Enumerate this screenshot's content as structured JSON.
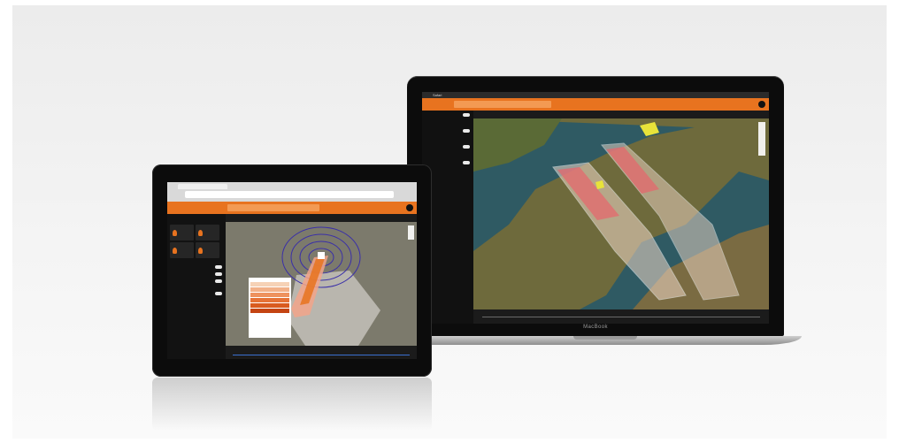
{
  "laptop": {
    "brand": "MacBook",
    "menubar": [
      "Safari"
    ],
    "search_placeholder": "",
    "map_title": "",
    "sidebar": [
      "",
      "",
      "",
      "",
      "",
      "",
      ""
    ]
  },
  "tablet": {
    "tab_title": "",
    "address": "",
    "search_placeholder": "",
    "map_title": "",
    "sidebar_header": "",
    "legend_title": ""
  },
  "colors": {
    "accent": "#e8731f",
    "panel": "#121212",
    "legend_ramp": [
      "#f6d2b6",
      "#f2b189",
      "#ee925e",
      "#e67236",
      "#d95b1f",
      "#c44412"
    ]
  }
}
